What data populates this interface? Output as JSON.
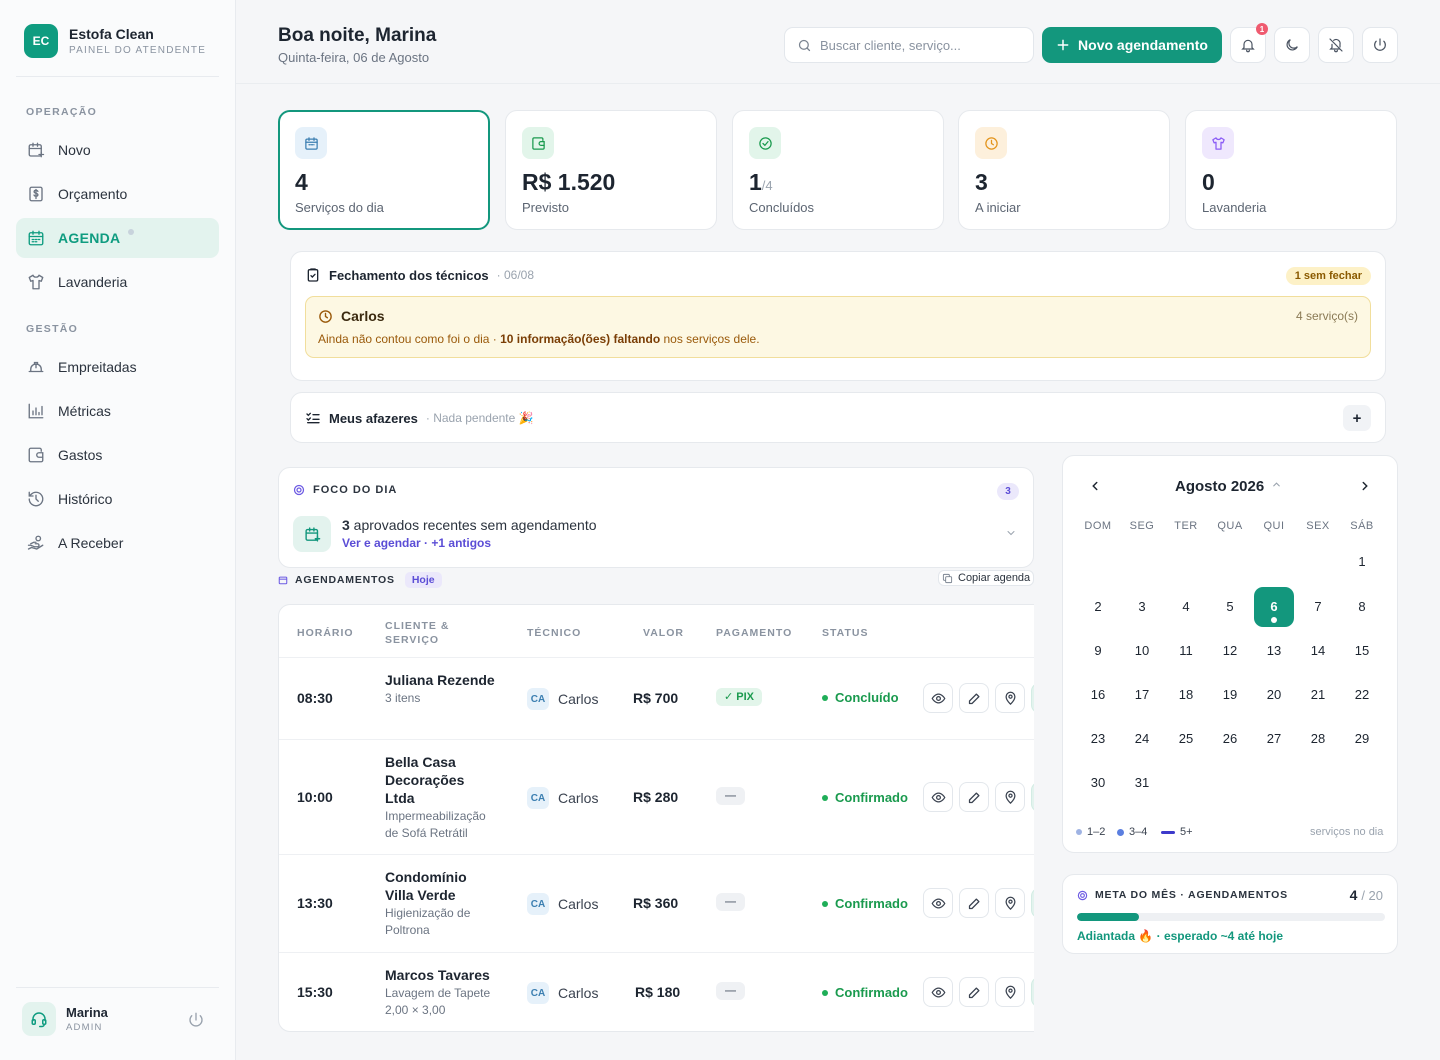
{
  "brand": {
    "initials": "EC",
    "name": "Estofa Clean",
    "subtitle": "PAINEL DO ATENDENTE"
  },
  "sidebar": {
    "section_operacao": "OPERAÇÃO",
    "section_gestao": "GESTÃO",
    "items": [
      {
        "label": "Novo",
        "icon": "calendar-plus-icon"
      },
      {
        "label": "Orçamento",
        "icon": "dollar-doc-icon"
      },
      {
        "label": "AGENDA",
        "icon": "calendar-icon"
      },
      {
        "label": "Lavanderia",
        "icon": "shirt-icon"
      },
      {
        "label": "Empreitadas",
        "icon": "helmet-icon"
      },
      {
        "label": "Métricas",
        "icon": "bar-chart-icon"
      },
      {
        "label": "Gastos",
        "icon": "wallet-icon"
      },
      {
        "label": "Histórico",
        "icon": "history-icon"
      },
      {
        "label": "A Receber",
        "icon": "hand-coins-icon"
      }
    ],
    "user": {
      "name": "Marina",
      "role": "ADMIN"
    }
  },
  "header": {
    "greeting": "Boa noite, Marina",
    "date": "Quinta-feira, 06 de Agosto",
    "search_placeholder": "Buscar cliente, serviço...",
    "new_button": "Novo agendamento",
    "notification_count": "1"
  },
  "stats": [
    {
      "value": "4",
      "suffix": "",
      "label": "Serviços do dia",
      "color": "#3c7fb1"
    },
    {
      "value": "R$ 1.520",
      "suffix": "",
      "label": "Previsto",
      "color": "#1a9a4e"
    },
    {
      "value": "1",
      "suffix": "/4",
      "label": "Concluídos",
      "color": "#1a9a4e"
    },
    {
      "value": "3",
      "suffix": "",
      "label": "A iniciar",
      "color": "#e3941c"
    },
    {
      "value": "0",
      "suffix": "",
      "label": "Lavanderia",
      "color": "#8b5cf6"
    }
  ],
  "fechamento": {
    "title": "Fechamento dos técnicos",
    "date": "· 06/08",
    "badge": "1 sem fechar",
    "tech_name": "Carlos",
    "services": "4 serviço(s)",
    "msg_prefix": "Ainda não contou como foi o dia · ",
    "msg_bold": "10 informação(ões) faltando",
    "msg_suffix": " nos serviços dele."
  },
  "afazeres": {
    "title": "Meus afazeres",
    "status": "· Nada pendente 🎉",
    "add": "+"
  },
  "foco": {
    "title": "FOCO DO DIA",
    "count": "3",
    "number": "3",
    "text": " aprovados recentes sem agendamento",
    "link": "Ver e agendar · +1 antigos"
  },
  "agendamentos": {
    "title": "AGENDAMENTOS",
    "filter": "Hoje",
    "copy": "Copiar agenda",
    "columns": {
      "horario": "HORÁRIO",
      "cliente1": "CLIENTE &",
      "cliente2": "SERVIÇO",
      "tecnico": "TÉCNICO",
      "valor": "VALOR",
      "pagamento": "PAGAMENTO",
      "status": "STATUS"
    },
    "rows": [
      {
        "time": "08:30",
        "client": "Juliana Rezende",
        "service": "3 itens",
        "tech_initials": "CA",
        "tech": "Carlos",
        "value": "R$ 700",
        "payment": "✓ PIX",
        "status": "Concluído"
      },
      {
        "time": "10:00",
        "client": "Bella Casa Decorações Ltda",
        "service": "Impermeabilização de Sofá Retrátil",
        "tech_initials": "CA",
        "tech": "Carlos",
        "value": "R$ 280",
        "payment": "—",
        "status": "Confirmado"
      },
      {
        "time": "13:30",
        "client": "Condomínio Villa Verde",
        "service": "Higienização de Poltrona",
        "tech_initials": "CA",
        "tech": "Carlos",
        "value": "R$ 360",
        "payment": "—",
        "status": "Confirmado"
      },
      {
        "time": "15:30",
        "client": "Marcos Tavares",
        "service": "Lavagem de Tapete 2,00 × 3,00",
        "tech_initials": "CA",
        "tech": "Carlos",
        "value": "R$ 180",
        "payment": "—",
        "status": "Confirmado"
      }
    ]
  },
  "calendar": {
    "month": "Agosto 2026",
    "weekdays": [
      "DOM",
      "SEG",
      "TER",
      "QUA",
      "QUI",
      "SEX",
      "SÁB"
    ],
    "first_weekday_index": 6,
    "days_in_month": 31,
    "today": 6,
    "legend": [
      "1–2",
      "3–4",
      "5+"
    ],
    "legend_caption": "serviços no dia"
  },
  "meta": {
    "title": "META DO MÊS · AGENDAMENTOS",
    "current": "4",
    "total": "/ 20",
    "progress_fraction": 0.2,
    "note_green": "Adiantada 🔥",
    "note_rest": " · esperado ~4 até hoje"
  }
}
